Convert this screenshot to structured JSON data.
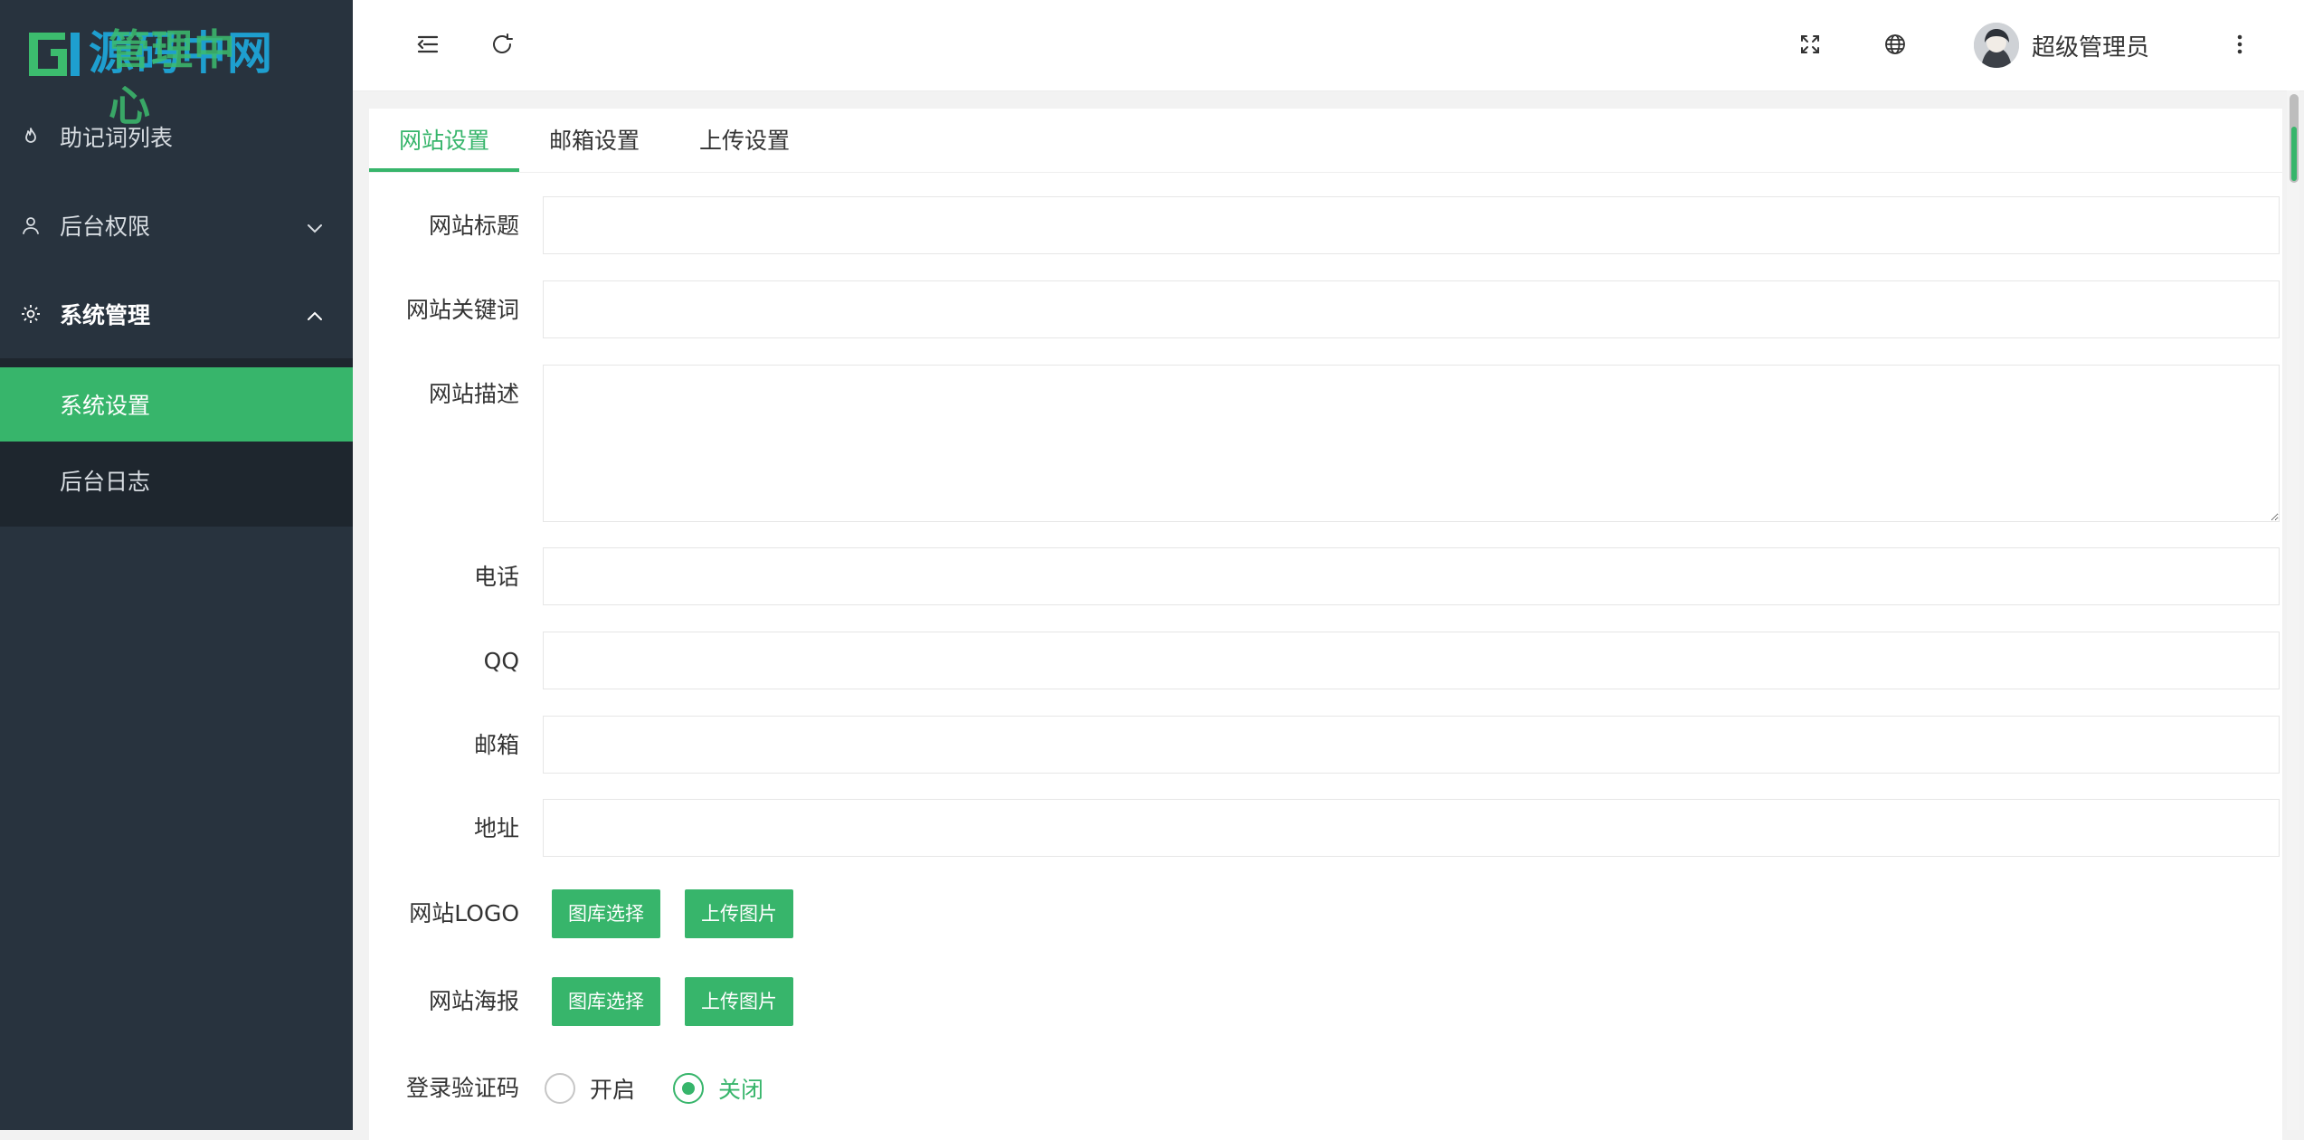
{
  "brand": {
    "logo_text": "源码中网",
    "logo_overlay": "管理中心"
  },
  "sidebar": {
    "items": [
      {
        "label": "助记词列表",
        "icon": "flame-icon"
      },
      {
        "label": "后台权限",
        "icon": "user-icon"
      },
      {
        "label": "系统管理",
        "icon": "gear-icon"
      }
    ],
    "submenu": [
      {
        "label": "系统设置",
        "active": true
      },
      {
        "label": "后台日志",
        "active": false
      }
    ]
  },
  "header": {
    "user_name": "超级管理员",
    "icons": [
      "menu-fold-icon",
      "refresh-icon",
      "fullscreen-icon",
      "globe-icon",
      "more-vertical-icon"
    ]
  },
  "tabs": [
    {
      "label": "网站设置",
      "active": true
    },
    {
      "label": "邮箱设置",
      "active": false
    },
    {
      "label": "上传设置",
      "active": false
    }
  ],
  "form": {
    "site_title": {
      "label": "网站标题",
      "value": "",
      "placeholder": ""
    },
    "site_keywords": {
      "label": "网站关键词",
      "value": "",
      "placeholder": ""
    },
    "site_description": {
      "label": "网站描述",
      "value": "",
      "placeholder": ""
    },
    "phone": {
      "label": "电话",
      "value": "",
      "placeholder": ""
    },
    "qq": {
      "label": "QQ",
      "value": "",
      "placeholder": ""
    },
    "email": {
      "label": "邮箱",
      "value": "",
      "placeholder": ""
    },
    "address": {
      "label": "地址",
      "value": "",
      "placeholder": ""
    },
    "logo": {
      "label": "网站LOGO",
      "gallery_button": "图库选择",
      "upload_button": "上传图片"
    },
    "poster": {
      "label": "网站海报",
      "gallery_button": "图库选择",
      "upload_button": "上传图片"
    },
    "captcha": {
      "label": "登录验证码",
      "options": [
        "开启",
        "关闭"
      ],
      "selected": "关闭"
    }
  },
  "colors": {
    "accent": "#37b56b",
    "sidebar_bg": "#28333e",
    "submenu_bg": "#1e262e"
  }
}
